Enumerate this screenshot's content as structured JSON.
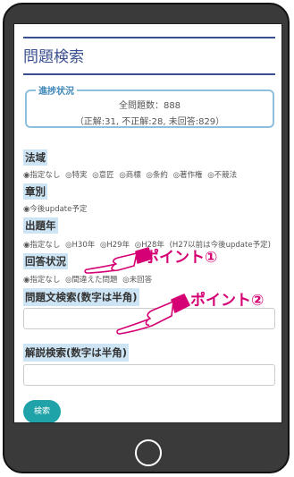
{
  "page": {
    "title": "問題検索"
  },
  "progress": {
    "legend": "進捗状況",
    "total_line": "全問題数：888",
    "detail_line": "（正解:31, 不正解:28, 未回答:829）"
  },
  "filters": {
    "domain": {
      "heading": "法域",
      "options": [
        "◉指定なし",
        "◎特実",
        "◎意匠",
        "◎商標",
        "◎条約",
        "◎著作権",
        "◎不競法"
      ]
    },
    "chapter": {
      "heading": "章別",
      "options": [
        "◉今後update予定"
      ]
    },
    "year": {
      "heading": "出題年",
      "options": [
        "◉指定なし",
        "◎H30年",
        "◎H29年",
        "◎H28年",
        "(H27以前は今後update予定)"
      ]
    },
    "answer_status": {
      "heading": "回答状況",
      "options": [
        "◉指定なし",
        "◎間違えた問題",
        "◎未回答"
      ]
    }
  },
  "search": {
    "question_text_label": "問題文検索(数字は半角)",
    "question_text_value": "",
    "explanation_label": "解説検索(数字は半角)",
    "explanation_value": "",
    "button_label": "検索"
  },
  "annotations": {
    "point1": "ポイント①",
    "point2": "ポイント②",
    "color": "#d40074"
  },
  "icons": {
    "pointer": "pointing-hand-icon",
    "home": "home-button-icon"
  }
}
